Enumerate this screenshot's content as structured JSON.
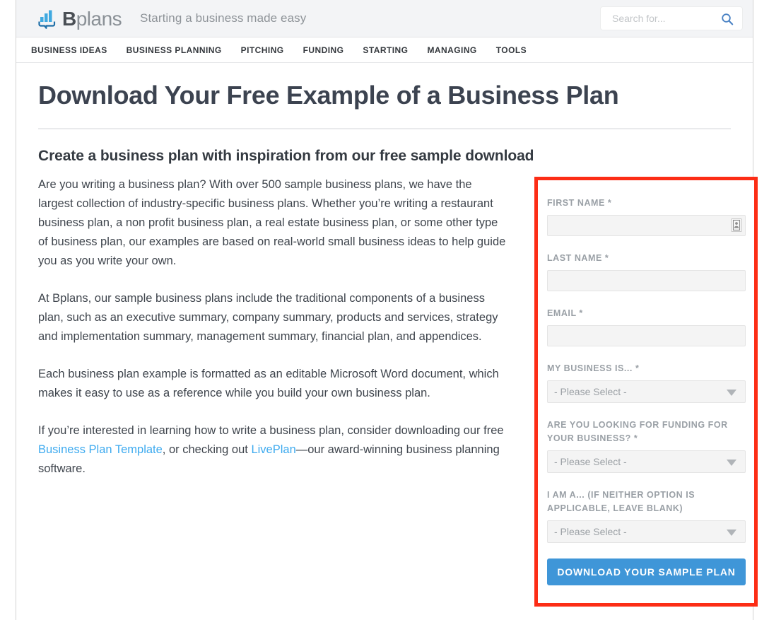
{
  "header": {
    "logo_text_bold": "B",
    "logo_text_rest": "plans",
    "logo_icon": "bar-chart-speech-bubble-icon",
    "tagline": "Starting a business made easy",
    "search": {
      "placeholder": "Search for...",
      "value": "",
      "icon": "search-icon"
    }
  },
  "nav": {
    "items": [
      {
        "label": "BUSINESS IDEAS"
      },
      {
        "label": "BUSINESS PLANNING"
      },
      {
        "label": "PITCHING"
      },
      {
        "label": "FUNDING"
      },
      {
        "label": "STARTING"
      },
      {
        "label": "MANAGING"
      },
      {
        "label": "TOOLS"
      }
    ]
  },
  "main": {
    "title": "Download Your Free Example of a Business Plan",
    "subtitle": "Create a business plan with inspiration from our free sample download",
    "paragraphs": {
      "p1": "Are you writing a business plan? With over 500 sample business plans, we have the largest collection of industry-specific business plans. Whether you’re writing a restaurant business plan, a non profit business plan, a real estate business plan, or some other type of business plan, our examples are based on real-world small business ideas to help guide you as you write your own.",
      "p2": "At Bplans, our sample business plans include the traditional components of a business plan, such as an executive summary, company summary, products and services, strategy and implementation summary, management summary, financial plan, and appendices.",
      "p3": "Each business plan example is formatted as an editable Microsoft Word document, which makes it easy to use as a reference while you build your own business plan.",
      "p4_part1": "If you’re interested in learning how to write a business plan, consider downloading our free ",
      "p4_link1": "Business Plan Template",
      "p4_part2": ", or checking out ",
      "p4_link2": "LivePlan",
      "p4_part3": "—our award-winning business planning software."
    }
  },
  "form": {
    "highlight_color": "#fc2d16",
    "fields": {
      "first_name_label": "FIRST NAME *",
      "first_name_value": "",
      "first_name_autofill_icon": "contact-card-autofill-icon",
      "last_name_label": "LAST NAME *",
      "last_name_value": "",
      "email_label": "EMAIL *",
      "email_value": "",
      "business_label": "MY BUSINESS IS... *",
      "business_value": "- Please Select -",
      "funding_label": "ARE YOU LOOKING FOR FUNDING FOR YOUR BUSINESS? *",
      "funding_value": "- Please Select -",
      "iama_label": "I AM A... (IF NEITHER OPTION IS APPLICABLE, LEAVE BLANK)",
      "iama_value": "- Please Select -"
    },
    "submit_label": "DOWNLOAD YOUR SAMPLE PLAN",
    "submit_color": "#3f96d8"
  }
}
